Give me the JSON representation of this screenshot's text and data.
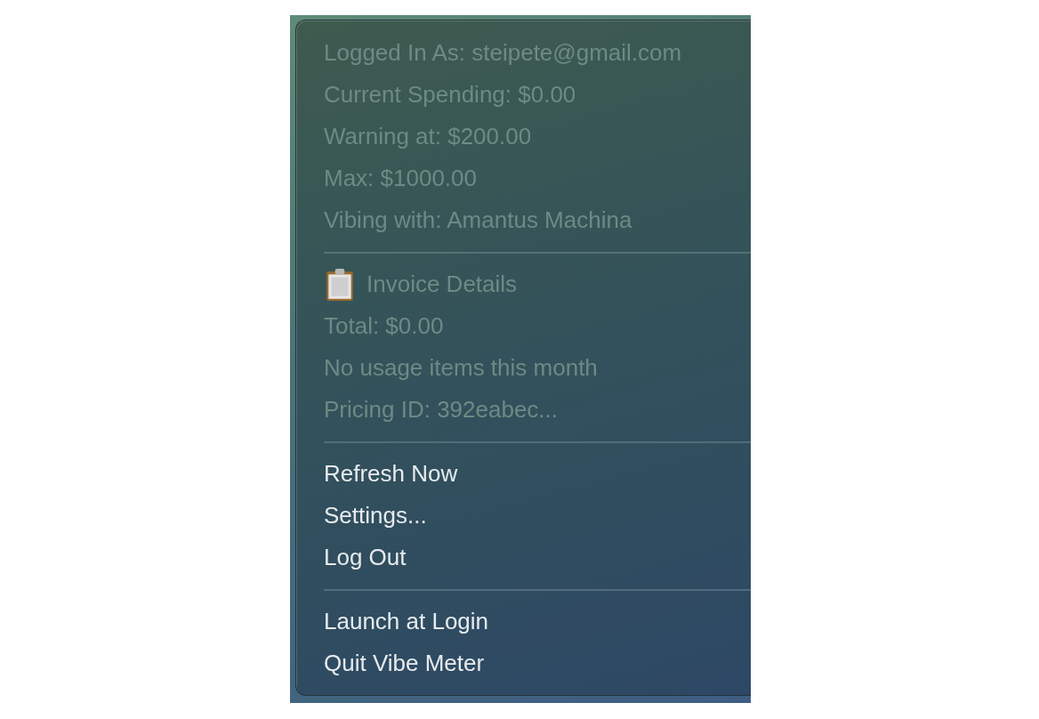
{
  "menu": {
    "items": [
      {
        "kind": "item",
        "label": "Logged In As: steipete@gmail.com",
        "disabled": true
      },
      {
        "kind": "item",
        "label": "Current Spending: $0.00",
        "disabled": true
      },
      {
        "kind": "item",
        "label": "Warning at: $200.00",
        "disabled": true
      },
      {
        "kind": "item",
        "label": "Max: $1000.00",
        "disabled": true
      },
      {
        "kind": "item",
        "label": "Vibing with: Amantus Machina",
        "disabled": true
      },
      {
        "kind": "separator"
      },
      {
        "kind": "header",
        "label": "Invoice Details",
        "disabled": true
      },
      {
        "kind": "item",
        "label": "Total: $0.00",
        "disabled": true
      },
      {
        "kind": "item",
        "label": "No usage items this month",
        "disabled": true
      },
      {
        "kind": "item",
        "label": "Pricing ID: 392eabec...",
        "disabled": true
      },
      {
        "kind": "separator"
      },
      {
        "kind": "item",
        "label": "Refresh Now",
        "disabled": false
      },
      {
        "kind": "item",
        "label": "Settings...",
        "disabled": false
      },
      {
        "kind": "item",
        "label": "Log Out",
        "disabled": false
      },
      {
        "kind": "separator"
      },
      {
        "kind": "item",
        "label": "Launch at Login",
        "disabled": false
      },
      {
        "kind": "item",
        "label": "Quit Vibe Meter",
        "disabled": false
      }
    ]
  }
}
